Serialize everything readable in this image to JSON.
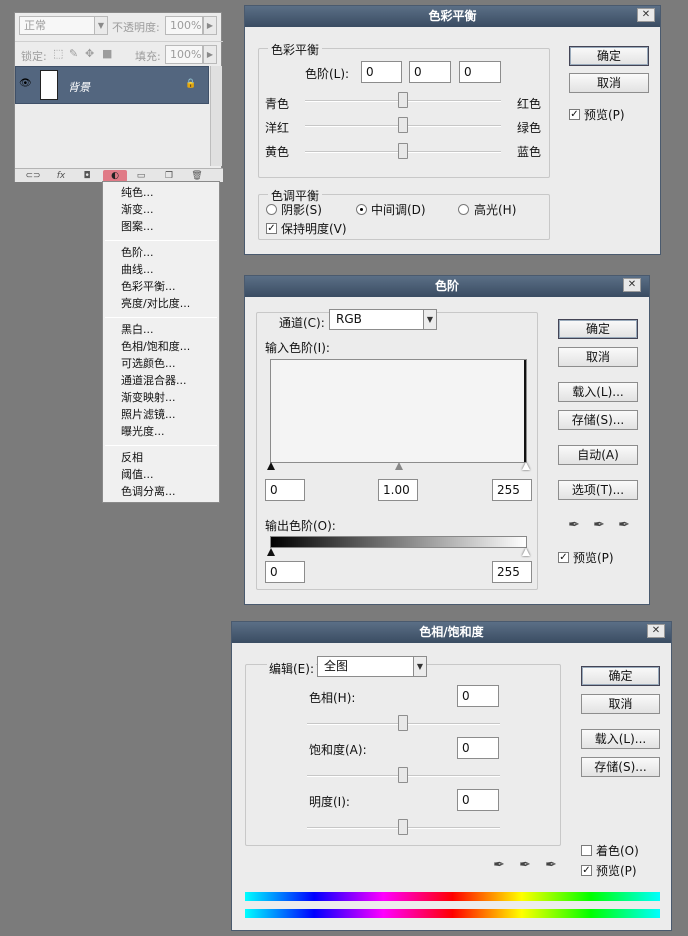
{
  "layers_panel": {
    "blend_mode": "正常",
    "opacity_label": "不透明度:",
    "opacity_value": "100%",
    "lock_label": "锁定:",
    "fill_label": "填充:",
    "fill_value": "100%",
    "layer_name": "背景"
  },
  "adjustment_menu": {
    "groups": [
      [
        "纯色...",
        "渐变...",
        "图案..."
      ],
      [
        "色阶...",
        "曲线...",
        "色彩平衡...",
        "亮度/对比度..."
      ],
      [
        "黑白...",
        "色相/饱和度...",
        "可选颜色...",
        "通道混合器...",
        "渐变映射...",
        "照片滤镜...",
        "曝光度..."
      ],
      [
        "反相",
        "阈值...",
        "色调分离..."
      ]
    ]
  },
  "color_balance": {
    "title": "色彩平衡",
    "group_title": "色彩平衡",
    "levels_label": "色阶(L):",
    "levels_values": [
      "0",
      "0",
      "0"
    ],
    "sliders": [
      {
        "left": "青色",
        "right": "红色",
        "value": 0
      },
      {
        "left": "洋红",
        "right": "绿色",
        "value": 0
      },
      {
        "left": "黄色",
        "right": "蓝色",
        "value": 0
      }
    ],
    "tone_group_title": "色调平衡",
    "tones": [
      "阴影(S)",
      "中间调(D)",
      "高光(H)"
    ],
    "selected_tone": "中间调(D)",
    "preserve_label": "保持明度(V)",
    "preserve_checked": true,
    "ok": "确定",
    "cancel": "取消",
    "preview": "预览(P)",
    "preview_checked": true
  },
  "levels": {
    "title": "色阶",
    "channel_label": "通道(C):",
    "channel_value": "RGB",
    "input_label": "输入色阶(I):",
    "input_values": [
      "0",
      "1.00",
      "255"
    ],
    "output_label": "输出色阶(O):",
    "output_values": [
      "0",
      "255"
    ],
    "ok": "确定",
    "cancel": "取消",
    "load": "载入(L)...",
    "save": "存储(S)...",
    "auto": "自动(A)",
    "options": "选项(T)...",
    "preview": "预览(P)",
    "preview_checked": true
  },
  "hue_saturation": {
    "title": "色相/饱和度",
    "edit_label": "编辑(E):",
    "edit_value": "全图",
    "hue_label": "色相(H):",
    "hue_value": "0",
    "sat_label": "饱和度(A):",
    "sat_value": "0",
    "light_label": "明度(I):",
    "light_value": "0",
    "ok": "确定",
    "cancel": "取消",
    "load": "载入(L)...",
    "save": "存储(S)...",
    "colorize": "着色(O)",
    "colorize_checked": false,
    "preview": "预览(P)",
    "preview_checked": true
  },
  "icons": {
    "close": "close-icon",
    "eye": "eye-icon",
    "eyedropper": "eyedropper-icon"
  }
}
